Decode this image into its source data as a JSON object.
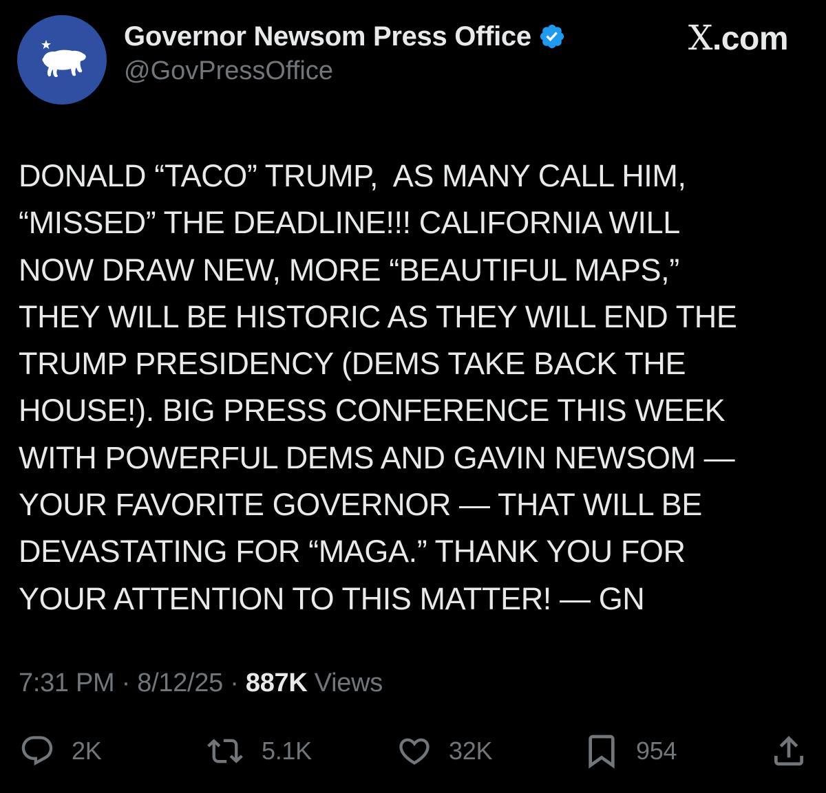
{
  "account": {
    "display_name": "Governor Newsom Press Office",
    "handle": "@GovPressOffice",
    "verified": true,
    "avatar_icon": "california-bear-flag-icon",
    "avatar_color": "#2f4fa3"
  },
  "site": {
    "x_letter": "X",
    "domain": ".com"
  },
  "tweet": {
    "lines": [
      "DONALD “TACO” TRUMP,  AS MANY CALL HIM,",
      "“MISSED” THE DEADLINE!!! CALIFORNIA WILL",
      "NOW DRAW NEW, MORE “BEAUTIFUL MAPS,”",
      "THEY WILL BE HISTORIC AS THEY WILL END THE",
      "TRUMP PRESIDENCY (DEMS TAKE BACK THE",
      "HOUSE!). BIG PRESS CONFERENCE THIS WEEK",
      "WITH POWERFUL DEMS AND GAVIN NEWSOM —",
      "YOUR FAVORITE GOVERNOR — THAT WILL BE",
      "DEVASTATING FOR “MAGA.” THANK YOU FOR",
      "YOUR ATTENTION TO THIS MATTER! — GN"
    ]
  },
  "meta": {
    "time": "7:31 PM",
    "separator": " · ",
    "date": "8/12/25",
    "views_count": "887K",
    "views_label": " Views"
  },
  "actions": {
    "replies": "2K",
    "reposts": "5.1K",
    "likes": "32K",
    "bookmarks": "954"
  },
  "colors": {
    "background": "#000000",
    "text": "#e7e9ea",
    "muted": "#71767b",
    "verified_badge": "#1d9bf0"
  }
}
